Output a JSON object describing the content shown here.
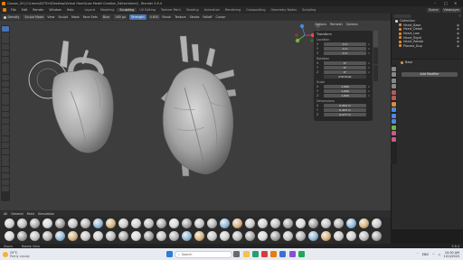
{
  "window": {
    "title": "Cosson_03 [C:\\Users\\DOTCH\\Desktop\\Virtual Heart\\Low Model Creation_Edited.blend] - Blender 3.6.4"
  },
  "menu": {
    "items": [
      "File",
      "Edit",
      "Render",
      "Window",
      "Help"
    ],
    "workspace_tabs": [
      "Layout",
      "Modeling",
      "Sculpting",
      "UV Editing",
      "Texture Paint",
      "Shading",
      "Animation",
      "Rendering",
      "Compositing",
      "Geometry Nodes",
      "Scripting"
    ],
    "active_workspace": "Sculpting",
    "scene_label": "Scene",
    "viewlayer_label": "ViewLayer"
  },
  "tool_header": {
    "brush_label": "Density",
    "mode": "Sculpt Mode",
    "menus": [
      "View",
      "Sculpt",
      "Mask",
      "Face Sets"
    ],
    "blue_chip": "Blue",
    "radius_value": "185 px",
    "strength_label": "Strength",
    "strength_value": "0.650",
    "dropdowns": [
      "Brush",
      "Texture",
      "Stroke",
      "Falloff",
      "Cursor"
    ]
  },
  "viewport": {
    "header_items": [
      "Options",
      "Remesh",
      "Options"
    ]
  },
  "n_panel": {
    "transform_title": "Transform",
    "location_title": "Location",
    "location": [
      {
        "axis": "X",
        "value": "0 m"
      },
      {
        "axis": "Y",
        "value": "0 m"
      },
      {
        "axis": "Z",
        "value": "0 m"
      }
    ],
    "rotation_title": "Rotation",
    "rotation": [
      {
        "axis": "X",
        "value": "0°"
      },
      {
        "axis": "Y",
        "value": "0°"
      },
      {
        "axis": "Z",
        "value": "0°"
      }
    ],
    "mode_value": "XYZ Euler",
    "scale_title": "Scale",
    "scale": [
      {
        "axis": "X",
        "value": "1.000"
      },
      {
        "axis": "Y",
        "value": "1.000"
      },
      {
        "axis": "Z",
        "value": "1.000"
      }
    ],
    "dimensions_title": "Dimensions",
    "dimensions": [
      {
        "axis": "X",
        "value": "0.452 m"
      },
      {
        "axis": "Y",
        "value": "0.453 m"
      },
      {
        "axis": "Z",
        "value": "0.277 m"
      }
    ]
  },
  "outliner": {
    "search_placeholder": "",
    "collection": "Collection",
    "items": [
      "Heart_Base",
      "Heart_Detail",
      "Heart_Low",
      "Heart_Right",
      "Heart_Rotate",
      "Plasma_Dup"
    ]
  },
  "properties": {
    "object_name": "Base",
    "add_modifier": "Add Modifier"
  },
  "asset_browser": {
    "tabs": [
      "All",
      "General",
      "Paint",
      "Simulation"
    ]
  },
  "status_bar": {
    "left": "Zoom",
    "middle": "Rotate View",
    "right": "3.6.4"
  },
  "taskbar": {
    "weather_temp": "23°C",
    "weather_desc": "Partly cloudy",
    "search_placeholder": "Search",
    "time": "10:30 AM",
    "date": "12/1/2023",
    "lang": "ENG"
  },
  "colors": {
    "accent": "#4772b3",
    "viewport_bg": "#3d3d3d",
    "axis_x": "#e54a4a",
    "axis_y": "#6fb83e",
    "axis_z": "#4f86e0"
  }
}
